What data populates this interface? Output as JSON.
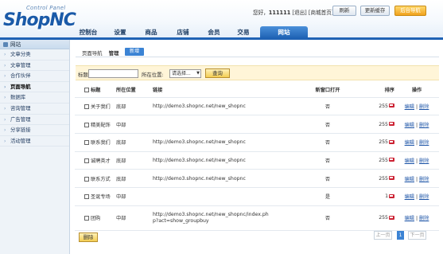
{
  "header": {
    "logo_sub": "Control Panel",
    "logo_main": "ShopNC",
    "greeting_prefix": "您好，",
    "username": "111111",
    "logout": "[退出]",
    "home": "[商城首页]",
    "buttons": {
      "refresh": "刷新",
      "update_cache": "更新缓存",
      "admin_nav": "后台导航"
    }
  },
  "nav": {
    "tabs": [
      "控制台",
      "设置",
      "商品",
      "店铺",
      "会员",
      "交易"
    ],
    "active": "网站"
  },
  "sidebar": {
    "head": "网站",
    "items": [
      "文章分类",
      "文章管理",
      "合作伙伴",
      "页面导航",
      "数据库",
      "咨询管理",
      "广告管理",
      "分享链接",
      "活动管理"
    ]
  },
  "main": {
    "crumb": "页面导航",
    "crumb_manage": "管理",
    "add": "新增",
    "filter": {
      "title_label": "标题:",
      "title_value": "",
      "location_label": "所在位置:",
      "location_value": "请选择...",
      "query": "查询"
    },
    "columns": {
      "title": "标题",
      "location": "所在位置",
      "link": "链接",
      "new_window": "新窗口打开",
      "sort": "排序",
      "ops": "操作"
    },
    "rows": [
      {
        "title": "关于我们",
        "location": "底部",
        "link": "http://demo3.shopnc.net/new_shopnc",
        "new_window": "否",
        "sort": "255",
        "edit": "编辑",
        "delete": "删除"
      },
      {
        "title": "精美配饰",
        "location": "中部",
        "link": "",
        "new_window": "否",
        "sort": "255",
        "edit": "编辑",
        "delete": "删除"
      },
      {
        "title": "联系我们",
        "location": "底部",
        "link": "http://demo3.shopnc.net/new_shopnc",
        "new_window": "否",
        "sort": "255",
        "edit": "编辑",
        "delete": "删除"
      },
      {
        "title": "诚聘英才",
        "location": "底部",
        "link": "http://demo3.shopnc.net/new_shopnc",
        "new_window": "否",
        "sort": "255",
        "edit": "编辑",
        "delete": "删除"
      },
      {
        "title": "联系方式",
        "location": "底部",
        "link": "http://demo3.shopnc.net/new_shopnc",
        "new_window": "否",
        "sort": "255",
        "edit": "编辑",
        "delete": "删除"
      },
      {
        "title": "圣诞专场",
        "location": "中部",
        "link": "",
        "new_window": "是",
        "sort": "1",
        "edit": "编辑",
        "delete": "删除"
      },
      {
        "title": "团购",
        "location": "中部",
        "link": "http://demo3.shopnc.net/new_shopnc/index.php?act=show_groupbuy",
        "new_window": "否",
        "sort": "255",
        "edit": "编辑",
        "delete": "删除"
      }
    ],
    "separator": "|",
    "delete_btn": "删除",
    "pager": {
      "prev": "上一页",
      "current": "1",
      "next": "下一页"
    }
  }
}
